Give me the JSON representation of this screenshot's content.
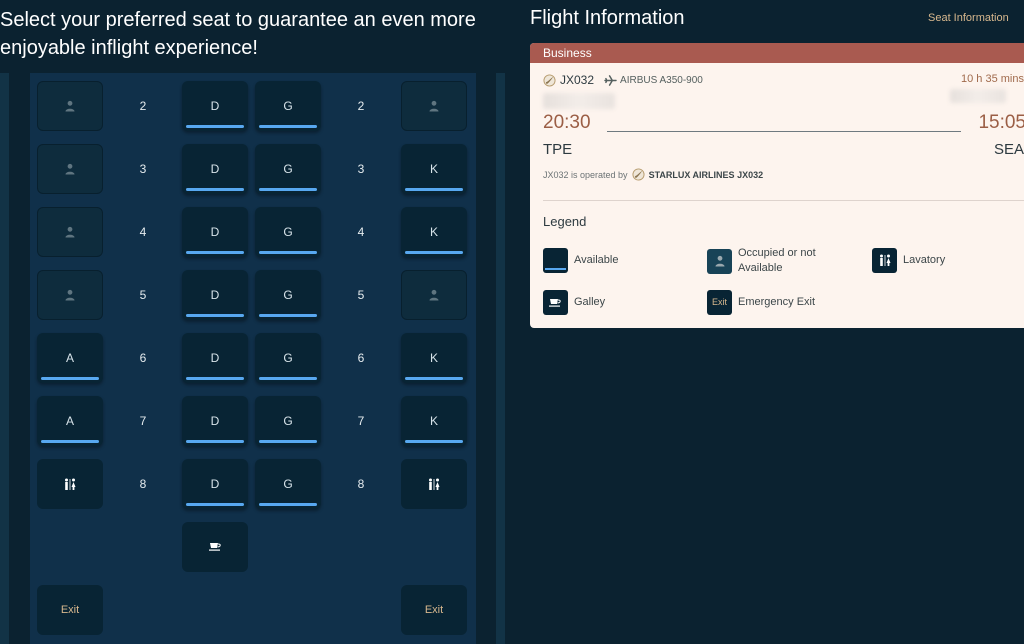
{
  "heading": "Select your preferred seat to guarantee an even more enjoyable inflight experience!",
  "cabin": {
    "rows": [
      {
        "row": "2",
        "left": {
          "kind": "occupied",
          "label": ""
        },
        "c1": {
          "kind": "available",
          "label": "D"
        },
        "c2": {
          "kind": "available",
          "label": "G"
        },
        "right": {
          "kind": "occupied",
          "label": ""
        }
      },
      {
        "row": "3",
        "left": {
          "kind": "occupied",
          "label": ""
        },
        "c1": {
          "kind": "available",
          "label": "D"
        },
        "c2": {
          "kind": "available",
          "label": "G"
        },
        "right": {
          "kind": "available",
          "label": "K"
        }
      },
      {
        "row": "4",
        "left": {
          "kind": "occupied",
          "label": ""
        },
        "c1": {
          "kind": "available",
          "label": "D"
        },
        "c2": {
          "kind": "available",
          "label": "G"
        },
        "right": {
          "kind": "available",
          "label": "K"
        }
      },
      {
        "row": "5",
        "left": {
          "kind": "occupied",
          "label": ""
        },
        "c1": {
          "kind": "available",
          "label": "D"
        },
        "c2": {
          "kind": "available",
          "label": "G"
        },
        "right": {
          "kind": "occupied",
          "label": ""
        }
      },
      {
        "row": "6",
        "left": {
          "kind": "available",
          "label": "A"
        },
        "c1": {
          "kind": "available",
          "label": "D"
        },
        "c2": {
          "kind": "available",
          "label": "G"
        },
        "right": {
          "kind": "available",
          "label": "K"
        }
      },
      {
        "row": "7",
        "left": {
          "kind": "available",
          "label": "A"
        },
        "c1": {
          "kind": "available",
          "label": "D"
        },
        "c2": {
          "kind": "available",
          "label": "G"
        },
        "right": {
          "kind": "available",
          "label": "K"
        }
      },
      {
        "row": "8",
        "left": {
          "kind": "lavatory",
          "label": ""
        },
        "c1": {
          "kind": "available",
          "label": "D"
        },
        "c2": {
          "kind": "available",
          "label": "G"
        },
        "right": {
          "kind": "lavatory",
          "label": ""
        }
      }
    ],
    "galley": {
      "kind": "galley"
    },
    "exit_left": "Exit",
    "exit_right": "Exit"
  },
  "flight_info": {
    "title": "Flight Information",
    "seat_info_link": "Seat Information",
    "cabin_class": "Business",
    "flight_no": "JX032",
    "aircraft": "AIRBUS A350-900",
    "duration": "10 h 35 mins",
    "dep_time": "20:30",
    "arr_time": "15:05",
    "dep_code": "TPE",
    "arr_code": "SEA",
    "operated_prefix": "JX032 is operated by",
    "operated_airline": "STARLUX AIRLINES JX032"
  },
  "legend": {
    "title": "Legend",
    "available": "Available",
    "occupied": "Occupied or not Available",
    "lavatory": "Lavatory",
    "galley": "Galley",
    "exit_box": "Exit",
    "exit": "Emergency Exit"
  },
  "colors": {
    "background": "#0b2230",
    "cabin": "#10304a",
    "seat": "#082434",
    "available_bar": "#58a8f0",
    "accent_gold": "#d8b88e",
    "card_header": "#a95a50",
    "card_bg": "#fdf4ee",
    "time_color": "#9b5e45"
  },
  "icons": {
    "occupied": "person-icon",
    "lavatory": "lavatory-icon",
    "galley": "coffee-cup-icon",
    "airline_logo": "starlux-logo-icon",
    "plane": "airplane-icon"
  }
}
